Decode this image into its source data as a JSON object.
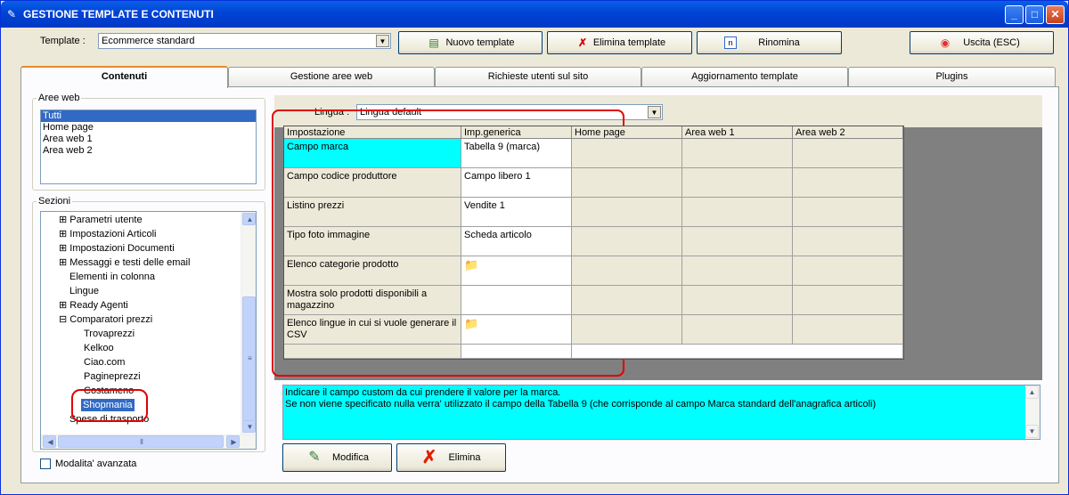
{
  "window": {
    "title": "GESTIONE TEMPLATE E CONTENUTI",
    "min": "_",
    "max": "□",
    "close": "✕"
  },
  "toolbar": {
    "template_label": "Template :",
    "template_value": "Ecommerce standard",
    "new_label": "Nuovo template",
    "delete_label": "Elimina template",
    "rename_label": "Rinomina",
    "exit_label": "Uscita (ESC)"
  },
  "tabs": [
    "Contenuti",
    "Gestione aree web",
    "Richieste utenti sul sito",
    "Aggiornamento template",
    "Plugins"
  ],
  "aree_web": {
    "label": "Aree web",
    "items": [
      "Tutti",
      "Home page",
      "Area web 1",
      "Area web 2"
    ]
  },
  "sezioni": {
    "label": "Sezioni",
    "items": [
      "Parametri utente",
      "Impostazioni Articoli",
      "Impostazioni Documenti",
      "Messaggi e testi delle email",
      "Elementi in colonna",
      "Lingue",
      "Ready Agenti",
      "Comparatori prezzi",
      "Trovaprezzi",
      "Kelkoo",
      "Ciao.com",
      "Pagineprezzi",
      "Costameno",
      "Shopmania",
      "Spese di trasporto"
    ]
  },
  "modalita": "Modalita' avanzata",
  "lingua": {
    "label": "Lingua :",
    "value": "Lingua default"
  },
  "grid": {
    "columns": [
      "Impostazione",
      "Imp.generica",
      "Home page",
      "Area web 1",
      "Area web 2"
    ],
    "rows": [
      {
        "name": "Campo marca",
        "value": "Tabella 9 (marca)"
      },
      {
        "name": "Campo codice produttore",
        "value": "Campo libero 1"
      },
      {
        "name": "Listino prezzi",
        "value": "Vendite 1"
      },
      {
        "name": "Tipo foto immagine",
        "value": "Scheda articolo"
      },
      {
        "name": "Elenco categorie prodotto",
        "value": ""
      },
      {
        "name": "Mostra solo prodotti disponibili a magazzino",
        "value": ""
      },
      {
        "name": "Elenco lingue in cui si vuole generare il CSV",
        "value": ""
      }
    ]
  },
  "description": {
    "line1": "Indicare il campo custom da cui prendere il valore per la marca.",
    "line2": "Se non viene specificato nulla verra' utilizzato il campo della Tabella 9 (che corrisponde al campo Marca standard dell'anagrafica articoli)"
  },
  "actions": {
    "modify": "Modifica",
    "delete": "Elimina"
  },
  "colors": {
    "titlebar": "#0043d6",
    "selection": "#316ac5",
    "highlight": "#00ffff",
    "annotation": "#e00000"
  }
}
